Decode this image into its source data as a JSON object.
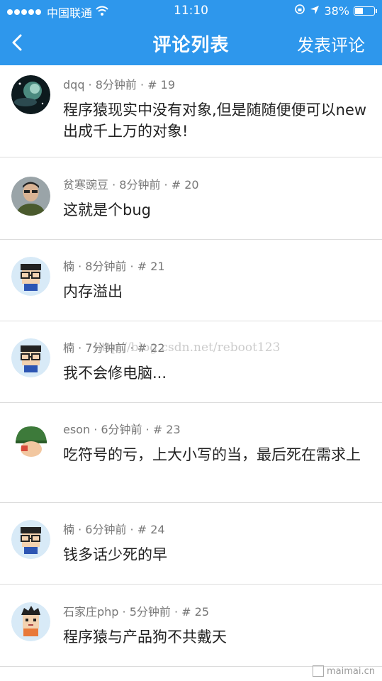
{
  "status_bar": {
    "carrier": "中国联通",
    "time": "11:10",
    "battery": "38%",
    "icons": [
      "signal-dots-icon",
      "wifi-icon",
      "rotation-lock-icon",
      "location-arrow-icon",
      "battery-icon"
    ]
  },
  "nav": {
    "back_icon": "chevron-left-icon",
    "title": "评论列表",
    "post_button": "发表评论"
  },
  "colors": {
    "nav_bg": "#2e97ec",
    "divider": "#dcdcdc",
    "meta_text": "#777777"
  },
  "comments": [
    {
      "user": "dqq",
      "time": "8分钟前",
      "floor": "# 19",
      "meta": "dqq · 8分钟前 · # 19",
      "text": "程序猿现实中没有对象,但是随随便便可以new出成千上万的对象!",
      "avatar_icon": "space-avatar"
    },
    {
      "user": "贫寒豌豆",
      "time": "8分钟前",
      "floor": "# 20",
      "meta": "贫寒豌豆 · 8分钟前 · # 20",
      "text": "这就是个bug",
      "avatar_icon": "photo-avatar"
    },
    {
      "user": "楠",
      "time": "8分钟前",
      "floor": "# 21",
      "meta": "楠 · 8分钟前 · # 21",
      "text": "内存溢出",
      "avatar_icon": "glasses-cartoon-avatar"
    },
    {
      "user": "楠",
      "time": "7分钟前",
      "floor": "# 22",
      "meta": "楠 · 7分钟前 · # 22",
      "text": "我不会修电脑...",
      "avatar_icon": "glasses-cartoon-avatar"
    },
    {
      "user": "eson",
      "time": "6分钟前",
      "floor": "# 23",
      "meta": "eson · 6分钟前 · # 23",
      "text": "吃符号的亏，上大小写的当，最后死在需求上",
      "avatar_icon": "helmet-cartoon-avatar"
    },
    {
      "user": "楠",
      "time": "6分钟前",
      "floor": "# 24",
      "meta": "楠 · 6分钟前 · # 24",
      "text": "钱多话少死的早",
      "avatar_icon": "glasses-cartoon-avatar"
    },
    {
      "user": "石家庄php",
      "time": "5分钟前",
      "floor": "# 25",
      "meta": "石家庄php · 5分钟前 · # 25",
      "text": "程序猿与产品狗不共戴天",
      "avatar_icon": "boy-cartoon-avatar"
    }
  ],
  "watermark": "http://blog.csdn.net/reboot123",
  "corner_logo": "maimai.cn"
}
